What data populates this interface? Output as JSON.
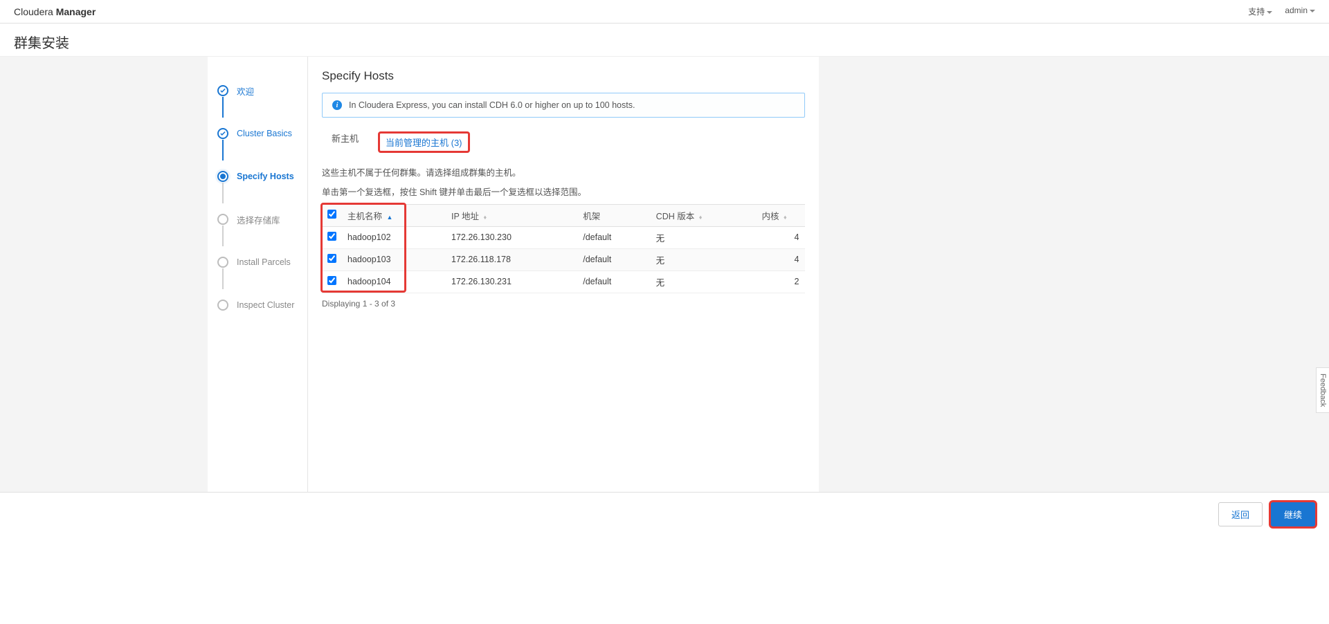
{
  "header": {
    "brand_light": "Cloudera",
    "brand_bold": "Manager",
    "support": "支持",
    "user": "admin"
  },
  "page_title": "群集安装",
  "sidebar": {
    "steps": [
      {
        "label": "欢迎",
        "state": "done"
      },
      {
        "label": "Cluster Basics",
        "state": "done"
      },
      {
        "label": "Specify Hosts",
        "state": "current"
      },
      {
        "label": "选择存储库",
        "state": "pending"
      },
      {
        "label": "Install Parcels",
        "state": "pending"
      },
      {
        "label": "Inspect Cluster",
        "state": "pending"
      }
    ]
  },
  "main": {
    "heading": "Specify Hosts",
    "info_message": "In Cloudera Express, you can install CDH 6.0 or higher on up to 100 hosts.",
    "tabs": {
      "new_host": "新主机",
      "managed_hosts": "当前管理的主机 (3)"
    },
    "desc_line1": "这些主机不属于任何群集。请选择组成群集的主机。",
    "desc_line2": "单击第一个复选框，按住 Shift 键并单击最后一个复选框以选择范围。",
    "columns": {
      "checkbox": "",
      "hostname": "主机名称",
      "ip": "IP 地址",
      "rack": "机架",
      "cdh_version": "CDH 版本",
      "cores": "内核"
    },
    "rows": [
      {
        "checked": true,
        "hostname": "hadoop102",
        "ip": "172.26.130.230",
        "rack": "/default",
        "cdh": "无",
        "cores": "4"
      },
      {
        "checked": true,
        "hostname": "hadoop103",
        "ip": "172.26.118.178",
        "rack": "/default",
        "cdh": "无",
        "cores": "4"
      },
      {
        "checked": true,
        "hostname": "hadoop104",
        "ip": "172.26.130.231",
        "rack": "/default",
        "cdh": "无",
        "cores": "2"
      }
    ],
    "footnote": "Displaying 1 - 3 of 3"
  },
  "footer": {
    "back": "返回",
    "continue": "继续"
  },
  "feedback_label": "Feedback"
}
